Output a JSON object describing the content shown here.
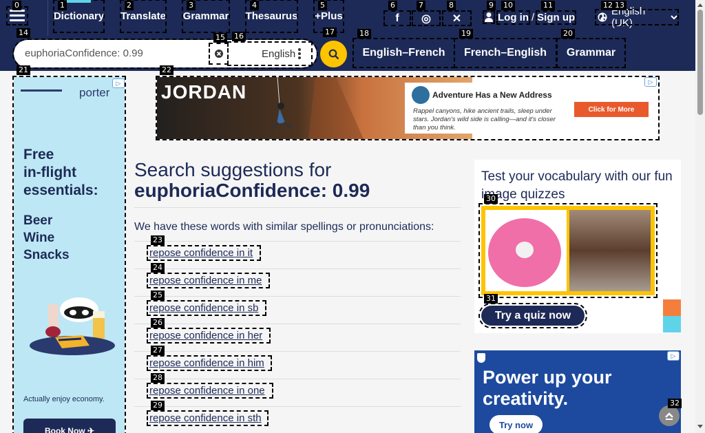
{
  "header": {
    "nav": [
      {
        "num": "1",
        "label": "Dictionary"
      },
      {
        "num": "2",
        "label": "Translate"
      },
      {
        "num": "3",
        "label": "Grammar"
      },
      {
        "num": "4",
        "label": "Thesaurus"
      },
      {
        "num": "5",
        "label": "+Plus"
      }
    ],
    "menu_num": "0",
    "social": [
      {
        "num": "6",
        "icon": "facebook-icon",
        "glyph": "f"
      },
      {
        "num": "7",
        "icon": "instagram-icon",
        "glyph": "◎"
      },
      {
        "num": "8",
        "icon": "x-twitter-icon",
        "glyph": "✕"
      }
    ],
    "login": {
      "num_icon": "9",
      "num_login": "10",
      "num_signup": "11",
      "login_label": "Log in",
      "separator": "/",
      "signup_label": "Sign up"
    },
    "language": {
      "num_a": "12",
      "num_b": "13",
      "label": "English (UK)"
    }
  },
  "search": {
    "num_bar": "14",
    "num_clear": "15",
    "num_lang": "16",
    "num_go": "17",
    "value": "euphoriaConfidence: 0.99",
    "placeholder": "",
    "language": "English",
    "tabs": [
      {
        "num": "18",
        "label": "English–French"
      },
      {
        "num": "19",
        "label": "French–English"
      },
      {
        "num": "20",
        "label": "Grammar"
      }
    ]
  },
  "ads": {
    "left": {
      "num": "21",
      "logo": "porter",
      "line1": "Free",
      "line2": "in-flight",
      "line3": "essentials:",
      "line4": "Beer",
      "line5": "Wine",
      "line6": "Snacks",
      "tagline": "Actually enjoy economy.",
      "cta": "Book Now"
    },
    "banner": {
      "num": "22",
      "brand": "JORDAN",
      "headline": "Adventure Has a New Address",
      "body": "Rappel canyons, hike ancient trails, sleep under stars. Jordan's wild side is calling—and it's closer than you think.",
      "cta": "Click for More"
    },
    "right": {
      "headline_1": "Power up your",
      "headline_2": "creativity.",
      "cta": "Try now"
    }
  },
  "main": {
    "title_prefix": "Search suggestions for",
    "title_query": "euphoriaConfidence: 0.99",
    "intro": "We have these words with similar spellings or pronunciations:",
    "suggestions": [
      {
        "num": "23",
        "label": "repose confidence in it"
      },
      {
        "num": "24",
        "label": "repose confidence in me"
      },
      {
        "num": "25",
        "label": "repose confidence in sb"
      },
      {
        "num": "26",
        "label": "repose confidence in her"
      },
      {
        "num": "27",
        "label": "repose confidence in him"
      },
      {
        "num": "28",
        "label": "repose confidence in one"
      },
      {
        "num": "29",
        "label": "repose confidence in sth"
      }
    ]
  },
  "quiz": {
    "title": "Test your vocabulary with our fun image quizzes",
    "num_image": "30",
    "num_button": "31",
    "button": "Try a quiz now"
  },
  "back_to_top_num": "32",
  "colors": {
    "brand": "#1d2a57",
    "accent": "#fec400",
    "link": "#1d2a57"
  }
}
